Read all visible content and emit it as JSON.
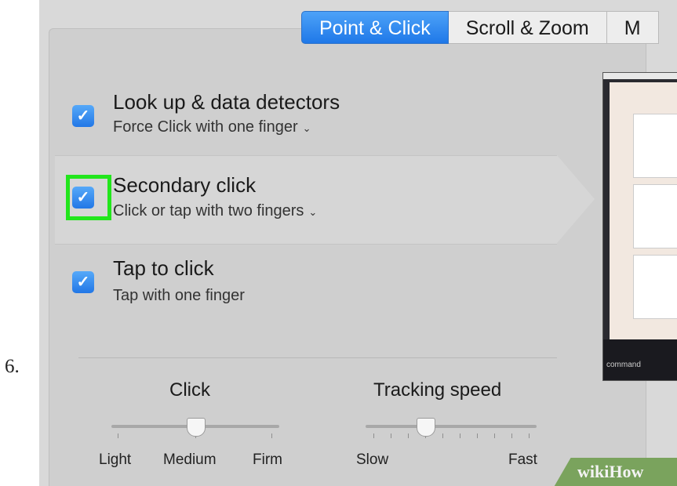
{
  "step": {
    "number": "6."
  },
  "tabs": [
    {
      "label": "Point & Click",
      "active": true
    },
    {
      "label": "Scroll & Zoom",
      "active": false
    },
    {
      "label": "M",
      "active": false
    }
  ],
  "options": [
    {
      "title": "Look up & data detectors",
      "subtitle": "Force Click with one finger",
      "checked": true,
      "has_dropdown": true
    },
    {
      "title": "Secondary click",
      "subtitle": "Click or tap with two fingers",
      "checked": true,
      "has_dropdown": true,
      "highlighted": true
    },
    {
      "title": "Tap to click",
      "subtitle": "Tap with one finger",
      "checked": true,
      "has_dropdown": false
    }
  ],
  "sliders": {
    "click": {
      "label": "Click",
      "min_label": "Light",
      "mid_label": "Medium",
      "max_label": "Firm",
      "value_fraction": 0.5
    },
    "tracking": {
      "label": "Tracking speed",
      "min_label": "Slow",
      "max_label": "Fast",
      "value_fraction": 0.35
    }
  },
  "preview": {
    "dock_label": "command"
  },
  "watermark": {
    "text": "wikiHow"
  },
  "icons": {
    "checkbox": "checkmark-icon",
    "dropdown": "chevron-down-icon"
  },
  "colors": {
    "accent": "#2277e6",
    "highlight_box": "#22e61c"
  }
}
